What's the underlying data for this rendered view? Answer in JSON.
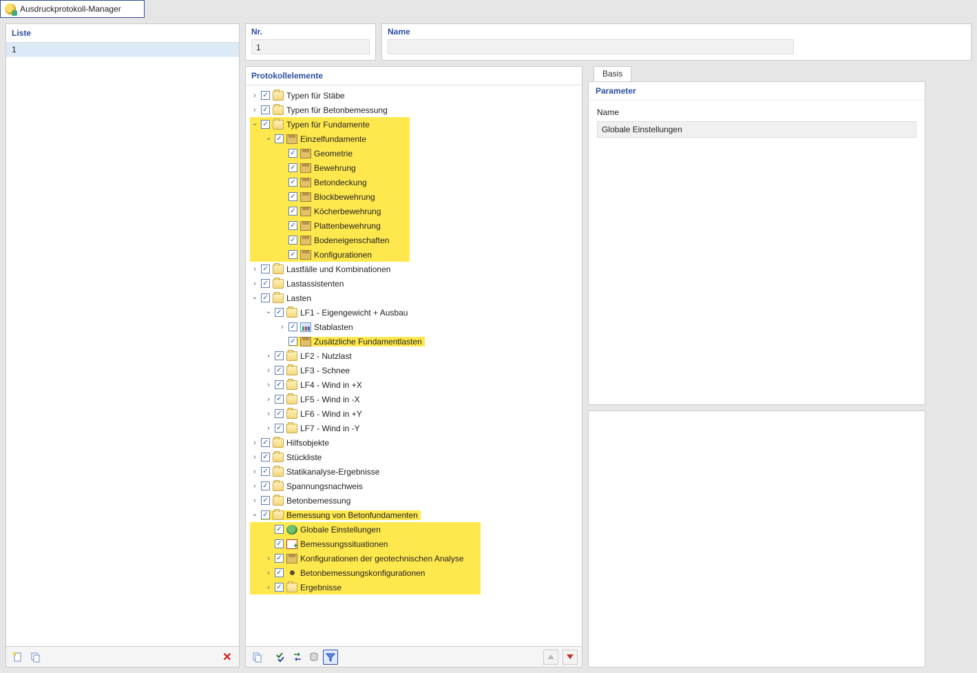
{
  "window": {
    "title": "Ausdruckprotokoll-Manager"
  },
  "left": {
    "header": "Liste",
    "rows": [
      "1"
    ]
  },
  "fields": {
    "nr": {
      "label": "Nr.",
      "value": "1"
    },
    "name": {
      "label": "Name",
      "value": ""
    }
  },
  "tree": {
    "header": "Protokollelemente",
    "items": [
      {
        "d": 0,
        "exp": ">",
        "chk": true,
        "icon": "folder",
        "label": "Typen für Stäbe"
      },
      {
        "d": 0,
        "exp": ">",
        "chk": true,
        "icon": "folder",
        "label": "Typen für Betonbemessung"
      },
      {
        "d": 0,
        "exp": "v",
        "chk": true,
        "icon": "folder",
        "label": "Typen für Fundamente",
        "hl": true
      },
      {
        "d": 1,
        "exp": "v",
        "chk": true,
        "icon": "foundation",
        "label": "Einzelfundamente",
        "hl": true
      },
      {
        "d": 2,
        "exp": "",
        "chk": true,
        "icon": "foundation",
        "label": "Geometrie",
        "hl": true
      },
      {
        "d": 2,
        "exp": "",
        "chk": true,
        "icon": "foundation",
        "label": "Bewehrung",
        "hl": true
      },
      {
        "d": 2,
        "exp": "",
        "chk": true,
        "icon": "foundation",
        "label": "Betondeckung",
        "hl": true
      },
      {
        "d": 2,
        "exp": "",
        "chk": true,
        "icon": "foundation",
        "label": "Blockbewehrung",
        "hl": true
      },
      {
        "d": 2,
        "exp": "",
        "chk": true,
        "icon": "foundation",
        "label": "Köcherbewehrung",
        "hl": true
      },
      {
        "d": 2,
        "exp": "",
        "chk": true,
        "icon": "foundation",
        "label": "Plattenbewehrung",
        "hl": true
      },
      {
        "d": 2,
        "exp": "",
        "chk": true,
        "icon": "foundation",
        "label": "Bodeneigenschaften",
        "hl": true
      },
      {
        "d": 2,
        "exp": "",
        "chk": true,
        "icon": "foundation",
        "label": "Konfigurationen",
        "hl": true
      },
      {
        "d": 0,
        "exp": ">",
        "chk": true,
        "icon": "folder",
        "label": "Lastfälle und Kombinationen"
      },
      {
        "d": 0,
        "exp": ">",
        "chk": true,
        "icon": "folder",
        "label": "Lastassistenten"
      },
      {
        "d": 0,
        "exp": "v",
        "chk": true,
        "icon": "folder",
        "label": "Lasten"
      },
      {
        "d": 1,
        "exp": "v",
        "chk": true,
        "icon": "folder",
        "label": "LF1 - Eigengewicht + Ausbau"
      },
      {
        "d": 2,
        "exp": ">",
        "chk": true,
        "icon": "bar",
        "label": "Stablasten"
      },
      {
        "d": 2,
        "exp": "",
        "chk": true,
        "icon": "foundation",
        "label": "Zusätzliche Fundamentlasten",
        "hl": true,
        "tight": true
      },
      {
        "d": 1,
        "exp": ">",
        "chk": true,
        "icon": "folder",
        "label": "LF2 - Nutzlast"
      },
      {
        "d": 1,
        "exp": ">",
        "chk": true,
        "icon": "folder",
        "label": "LF3 - Schnee"
      },
      {
        "d": 1,
        "exp": ">",
        "chk": true,
        "icon": "folder",
        "label": "LF4 - Wind in +X"
      },
      {
        "d": 1,
        "exp": ">",
        "chk": true,
        "icon": "folder",
        "label": "LF5 - Wind in -X"
      },
      {
        "d": 1,
        "exp": ">",
        "chk": true,
        "icon": "folder",
        "label": "LF6 - Wind in +Y"
      },
      {
        "d": 1,
        "exp": ">",
        "chk": true,
        "icon": "folder",
        "label": "LF7 - Wind in -Y"
      },
      {
        "d": 0,
        "exp": ">",
        "chk": true,
        "icon": "folder",
        "label": "Hilfsobjekte"
      },
      {
        "d": 0,
        "exp": ">",
        "chk": true,
        "icon": "folder",
        "label": "Stückliste"
      },
      {
        "d": 0,
        "exp": ">",
        "chk": true,
        "icon": "folder",
        "label": "Statikanalyse-Ergebnisse"
      },
      {
        "d": 0,
        "exp": ">",
        "chk": true,
        "icon": "folder",
        "label": "Spannungsnachweis"
      },
      {
        "d": 0,
        "exp": ">",
        "chk": true,
        "icon": "folder",
        "label": "Betonbemessung"
      },
      {
        "d": 0,
        "exp": "v",
        "chk": true,
        "icon": "folder",
        "label": "Bemessung von Betonfundamenten",
        "hl": true,
        "tight": true
      },
      {
        "d": 1,
        "exp": "",
        "chk": true,
        "icon": "globe",
        "label": "Globale Einstellungen",
        "hl": true,
        "selected": true
      },
      {
        "d": 1,
        "exp": "",
        "chk": true,
        "icon": "sit",
        "label": "Bemessungssituationen",
        "hl": true
      },
      {
        "d": 1,
        "exp": ">",
        "chk": true,
        "icon": "foundation",
        "label": "Konfigurationen der geotechnischen Analyse",
        "hl": true
      },
      {
        "d": 1,
        "exp": ">",
        "chk": true,
        "icon": "dot",
        "label": "Betonbemessungskonfigurationen",
        "hl": true
      },
      {
        "d": 1,
        "exp": ">",
        "chk": true,
        "icon": "folder",
        "label": "Ergebnisse",
        "hl": true
      }
    ]
  },
  "right": {
    "tab": "Basis",
    "param_header": "Parameter",
    "param_name_label": "Name",
    "param_name_value": "Globale Einstellungen"
  },
  "icons": {
    "new": "new-doc-icon",
    "copy": "copy-icon",
    "delete": "delete-icon",
    "checkall": "check-all-icon",
    "swap": "swap-icon",
    "db": "database-icon",
    "filter": "filter-icon",
    "up": "up-icon",
    "down": "down-icon"
  }
}
